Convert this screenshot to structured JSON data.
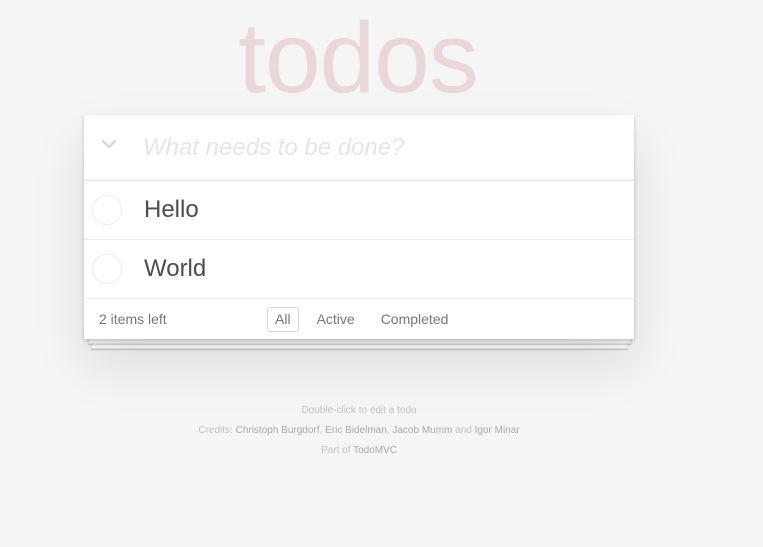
{
  "app": {
    "title": "todos"
  },
  "header": {
    "toggle_all_icon": "chevron-down-icon",
    "new_todo_placeholder": "What needs to be done?",
    "new_todo_value": ""
  },
  "todos": [
    {
      "label": "Hello",
      "completed": false
    },
    {
      "label": "World",
      "completed": false
    }
  ],
  "footer": {
    "count_text": "2 items left",
    "filters": [
      {
        "label": "All",
        "selected": true
      },
      {
        "label": "Active",
        "selected": false
      },
      {
        "label": "Completed",
        "selected": false
      }
    ]
  },
  "info": {
    "hint": "Double-click to edit a todo",
    "credits_prefix": "Credits: ",
    "credits": [
      "Christoph Burgdorf",
      "Eric Bidelman",
      "Jacob Mumm",
      "Igor Minar"
    ],
    "credits_sep_1": ", ",
    "credits_sep_2": ", ",
    "credits_and": " and ",
    "part_of_prefix": "Part of ",
    "part_of_link": "TodoMVC"
  },
  "colors": {
    "title": "#efd5d5",
    "background": "#f5f5f5",
    "text": "#4d4d4d",
    "muted": "#777777"
  }
}
